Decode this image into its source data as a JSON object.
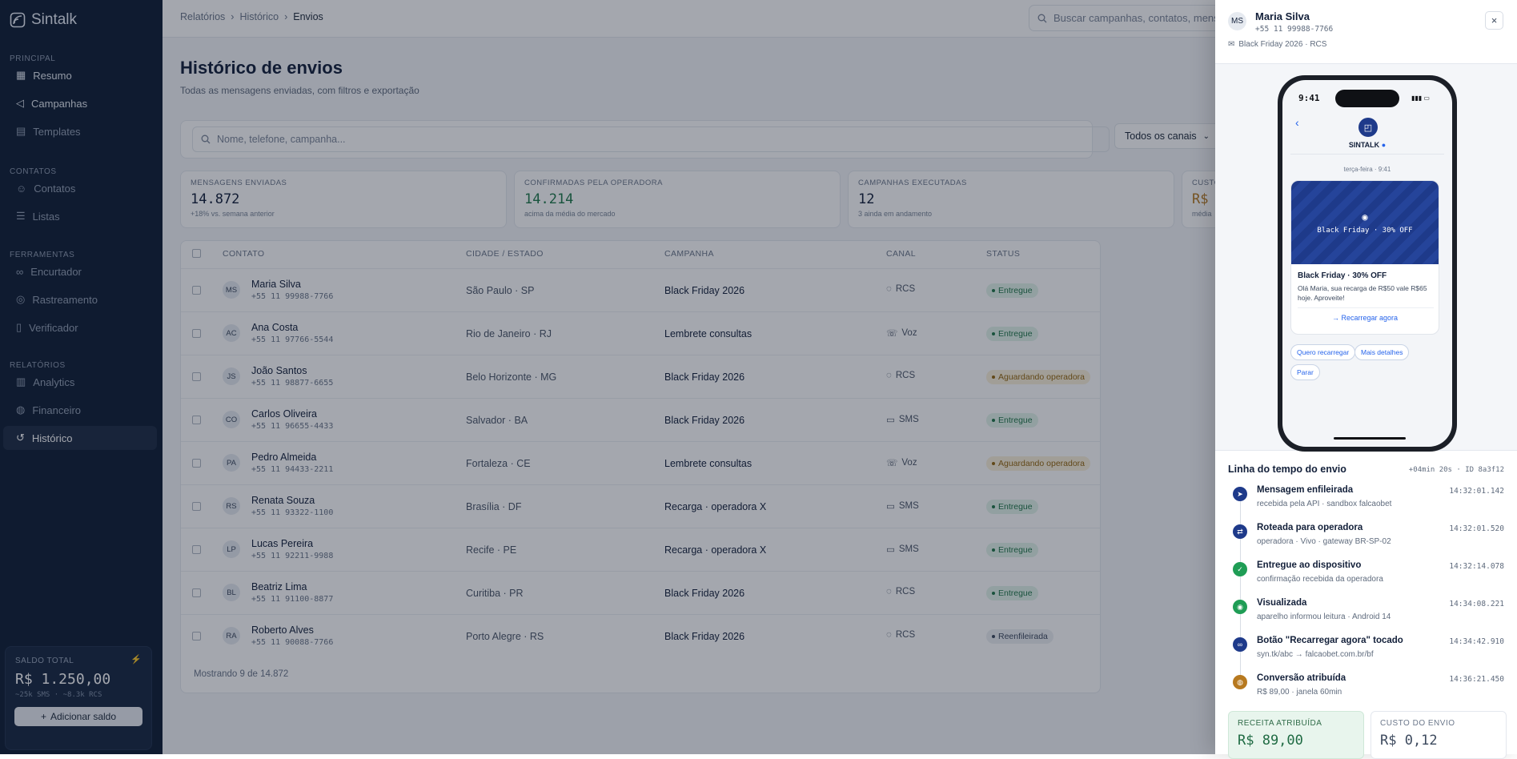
{
  "app": {
    "name": "Sintalk"
  },
  "sidebar": {
    "sections": [
      {
        "title": "PRINCIPAL",
        "items": [
          {
            "label": "Resumo",
            "icon": "grid-icon"
          },
          {
            "label": "Campanhas",
            "icon": "megaphone-icon"
          },
          {
            "label": "Templates",
            "icon": "file-icon"
          }
        ]
      },
      {
        "title": "CONTATOS",
        "items": [
          {
            "label": "Contatos",
            "icon": "user-icon"
          },
          {
            "label": "Listas",
            "icon": "list-icon"
          }
        ]
      },
      {
        "title": "FERRAMENTAS",
        "items": [
          {
            "label": "Encurtador",
            "icon": "link-icon"
          },
          {
            "label": "Rastreamento",
            "icon": "target-icon"
          },
          {
            "label": "Verificador",
            "icon": "phone-icon"
          }
        ]
      },
      {
        "title": "RELATÓRIOS",
        "items": [
          {
            "label": "Analytics",
            "icon": "chart-icon"
          },
          {
            "label": "Financeiro",
            "icon": "coin-icon"
          },
          {
            "label": "Histórico",
            "icon": "history-icon"
          }
        ]
      }
    ],
    "balance": {
      "label": "SALDO TOTAL",
      "value": "R$ 1.250,00",
      "sub": "~25k SMS · ~8.3k RCS",
      "button": "Adicionar saldo"
    }
  },
  "header": {
    "breadcrumb": [
      "Relatórios",
      "Histórico",
      "Envios"
    ],
    "search_placeholder": "Buscar campanhas, contatos, mensagens..."
  },
  "page": {
    "title": "Histórico de envios",
    "subtitle": "Todas as mensagens enviadas, com filtros e exportação",
    "filter_placeholder": "Nome, telefone, campanha...",
    "channel_select": "Todos os canais"
  },
  "stats": [
    {
      "label": "MENSAGENS ENVIADAS",
      "value": "14.872",
      "sub": "+18% vs. semana anterior",
      "color": "#13203a"
    },
    {
      "label": "CONFIRMADAS PELA OPERADORA",
      "value": "14.214",
      "sub": "acima da média do mercado",
      "color": "#1f7a4b"
    },
    {
      "label": "CAMPANHAS EXECUTADAS",
      "value": "12",
      "sub": "3 ainda em andamento",
      "color": "#13203a"
    },
    {
      "label": "CUSTO",
      "value": "R$",
      "sub": "média",
      "color": "#b7791f"
    }
  ],
  "table": {
    "columns": [
      "CONTATO",
      "CIDADE / ESTADO",
      "CAMPANHA",
      "CANAL",
      "STATUS"
    ],
    "rows": [
      {
        "initials": "MS",
        "name": "Maria Silva",
        "phone": "+55 11 99988-7766",
        "city": "São Paulo · SP",
        "campaign": "Black Friday 2026",
        "channel": "RCS",
        "status": "Entregue",
        "kind": "ok"
      },
      {
        "initials": "AC",
        "name": "Ana Costa",
        "phone": "+55 11 97766-5544",
        "city": "Rio de Janeiro · RJ",
        "campaign": "Lembrete consultas",
        "channel": "Voz",
        "status": "Entregue",
        "kind": "ok"
      },
      {
        "initials": "JS",
        "name": "João Santos",
        "phone": "+55 11 98877-6655",
        "city": "Belo Horizonte · MG",
        "campaign": "Black Friday 2026",
        "channel": "RCS",
        "status": "Aguardando operadora",
        "kind": "wait"
      },
      {
        "initials": "CO",
        "name": "Carlos Oliveira",
        "phone": "+55 11 96655-4433",
        "city": "Salvador · BA",
        "campaign": "Black Friday 2026",
        "channel": "SMS",
        "status": "Entregue",
        "kind": "ok"
      },
      {
        "initials": "PA",
        "name": "Pedro Almeida",
        "phone": "+55 11 94433-2211",
        "city": "Fortaleza · CE",
        "campaign": "Lembrete consultas",
        "channel": "Voz",
        "status": "Aguardando operadora",
        "kind": "wait"
      },
      {
        "initials": "RS",
        "name": "Renata Souza",
        "phone": "+55 11 93322-1100",
        "city": "Brasília · DF",
        "campaign": "Recarga · operadora X",
        "channel": "SMS",
        "status": "Entregue",
        "kind": "ok"
      },
      {
        "initials": "LP",
        "name": "Lucas Pereira",
        "phone": "+55 11 92211-9988",
        "city": "Recife · PE",
        "campaign": "Recarga · operadora X",
        "channel": "SMS",
        "status": "Entregue",
        "kind": "ok"
      },
      {
        "initials": "BL",
        "name": "Beatriz Lima",
        "phone": "+55 11 91100-8877",
        "city": "Curitiba · PR",
        "campaign": "Black Friday 2026",
        "channel": "RCS",
        "status": "Entregue",
        "kind": "ok"
      },
      {
        "initials": "RA",
        "name": "Roberto Alves",
        "phone": "+55 11 90088-7766",
        "city": "Porto Alegre · RS",
        "campaign": "Black Friday 2026",
        "channel": "RCS",
        "status": "Reenfileirada",
        "kind": "re"
      }
    ],
    "footer": "Mostrando 9 de 14.872"
  },
  "panel": {
    "initials": "MS",
    "name": "Maria Silva",
    "phone": "+55 11 99988-7766",
    "campaign": "Black Friday 2026 · RCS",
    "close_label": "×",
    "device": {
      "time": "9:41",
      "brand": "SINTALK",
      "day": "terça-feira · 9:41",
      "banner": "Black Friday · 30% OFF",
      "card_title": "Black Friday · 30% OFF",
      "card_text": "Olá Maria, sua recarga de R$50 vale R$65 hoje. Aproveite!",
      "card_action": "→ Recarregar agora",
      "chips": [
        "Quero recarregar",
        "Mais detalhes",
        "Parar"
      ]
    },
    "timeline": {
      "title": "Linha do tempo do envio",
      "meta": "+04min 20s · ID 8a3f12",
      "events": [
        {
          "title": "Mensagem enfileirada",
          "sub": "recebida pela API · sandbox falcaobet",
          "time": "14:32:01.142",
          "color": "#1e3a8a",
          "icon": "send-icon"
        },
        {
          "title": "Roteada para operadora",
          "sub": "operadora · Vivo · gateway BR-SP-02",
          "time": "14:32:01.520",
          "color": "#1e3a8a",
          "icon": "route-icon"
        },
        {
          "title": "Entregue ao dispositivo",
          "sub": "confirmação recebida da operadora",
          "time": "14:32:14.078",
          "color": "#1f9d55",
          "icon": "check-icon"
        },
        {
          "title": "Visualizada",
          "sub": "aparelho informou leitura · Android 14",
          "time": "14:34:08.221",
          "color": "#1f9d55",
          "icon": "eye-icon"
        },
        {
          "title": "Botão \"Recarregar agora\" tocado",
          "sub": "syn.tk/abc → falcaobet.com.br/bf",
          "time": "14:34:42.910",
          "color": "#1e3a8a",
          "icon": "link-icon"
        },
        {
          "title": "Conversão atribuída",
          "sub": "R$ 89,00 · janela 60min",
          "time": "14:36:21.450",
          "color": "#b7791f",
          "icon": "coin-icon"
        }
      ]
    },
    "revenue": {
      "label": "RECEITA ATRIBUÍDA",
      "value": "R$ 89,00"
    },
    "cost": {
      "label": "CUSTO DO ENVIO",
      "value": "R$ 0,12"
    }
  }
}
